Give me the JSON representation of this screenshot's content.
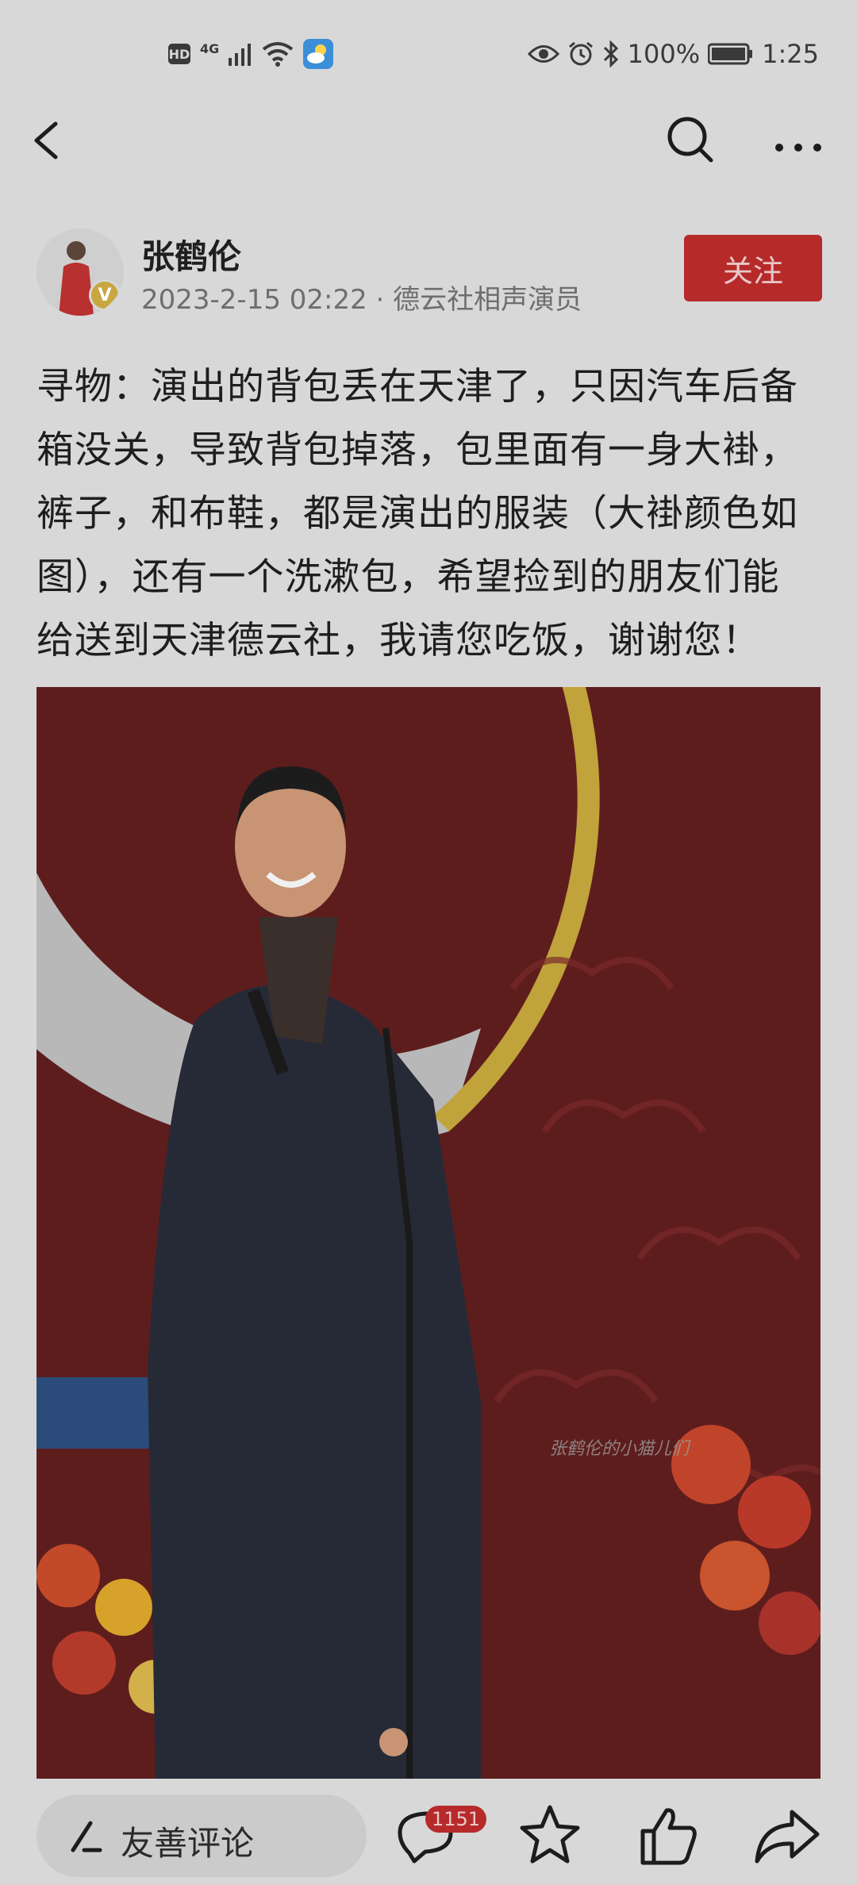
{
  "status_bar": {
    "hd": "HD",
    "network": "4G",
    "battery": "100%",
    "time": "1:25"
  },
  "app_bar": {
    "icons": [
      "back-arrow-icon",
      "search-icon",
      "more-icon"
    ]
  },
  "author": {
    "name": "张鹤伦",
    "meta": "2023-2-15 02:22 · 德云社相声演员",
    "verified_mark": "V",
    "follow_label": "关注"
  },
  "post": {
    "lines": [
      "寻物：演出的背包丢在天津了，只因汽车后备",
      "箱没关，导致背包掉落，包里面有一身大褂，",
      "裤子，和布鞋，都是演出的服装（大褂颜色如",
      "图），还有一个洗漱包，希望捡到的朋友们能",
      "给送到天津德云社，我请您吃饭，谢谢您！"
    ],
    "image_watermark": "张鹤伦的小猫儿们"
  },
  "bottom_bar": {
    "comment_placeholder": "友善评论",
    "comment_count": "1151",
    "icons": [
      "pen-icon",
      "comment-icon",
      "star-icon",
      "thumbs-up-icon",
      "share-icon"
    ]
  },
  "colors": {
    "accent": "#b72a2a",
    "background": "#d8d8d8",
    "badge_gold": "#c8a640"
  }
}
